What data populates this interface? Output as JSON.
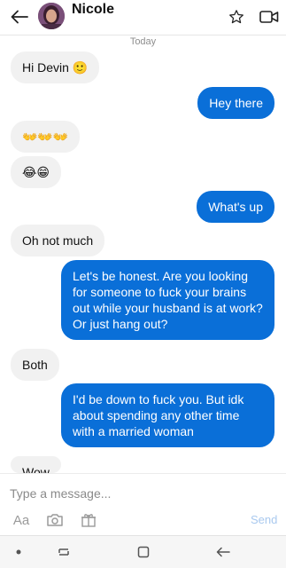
{
  "header": {
    "contact_name": "Nicole",
    "back_icon": "arrow-left-icon",
    "star_icon": "star-icon",
    "video_icon": "video-call-icon"
  },
  "conversation": {
    "day_label": "Today",
    "messages": [
      {
        "direction": "incoming",
        "text": "Hi Devin 🙂"
      },
      {
        "direction": "outgoing",
        "text": "Hey there"
      },
      {
        "direction": "incoming",
        "text": "👐👐👐"
      },
      {
        "direction": "incoming",
        "text": "😂😁"
      },
      {
        "direction": "outgoing",
        "text": "What's up"
      },
      {
        "direction": "incoming",
        "text": "Oh not much"
      },
      {
        "direction": "outgoing",
        "text": "Let's be honest. Are you looking for someone to fuck your brains out while your husband is at work? Or just hang out?"
      },
      {
        "direction": "incoming",
        "text": "Both"
      },
      {
        "direction": "outgoing",
        "text": "I'd be down to fuck you. But idk about spending any other time with a married woman"
      },
      {
        "direction": "incoming",
        "text": "Wow"
      }
    ]
  },
  "composer": {
    "placeholder": "Type a message...",
    "text_format_label": "Aa",
    "camera_icon": "camera-icon",
    "gift_icon": "gift-icon",
    "send_label": "Send"
  },
  "system_nav": {
    "dot_icon": "dot-icon",
    "recents_icon": "recents-icon",
    "home_icon": "home-icon",
    "back_icon": "back-icon"
  },
  "colors": {
    "outgoing_bubble": "#0a6fd8",
    "incoming_bubble": "#f1f1f1",
    "send_disabled": "#a9c9ef"
  }
}
